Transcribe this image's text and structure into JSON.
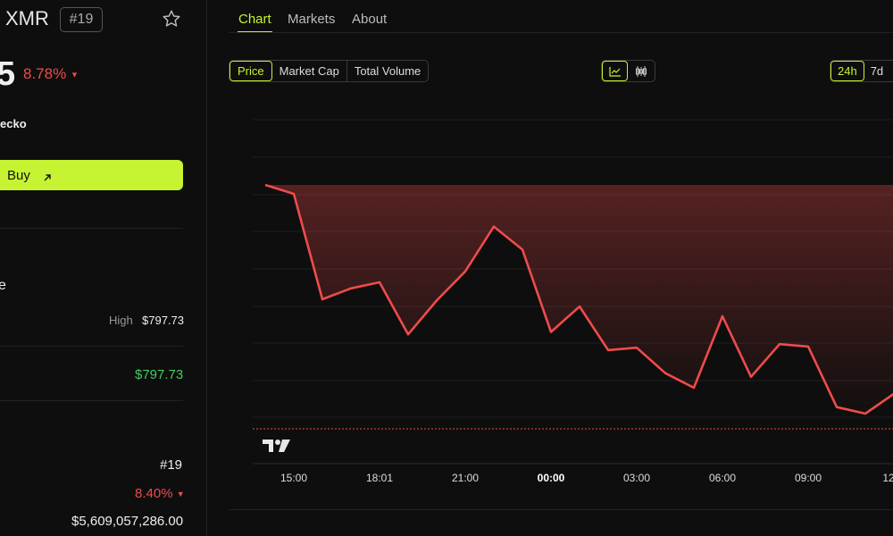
{
  "coin": {
    "ticker": "XMR",
    "rank_badge": "#19",
    "price_fragment": "5",
    "change_24h": "8.78%",
    "brand_fragment": "ecko",
    "buy_label": "Buy",
    "section_fragment": "e",
    "high_label": "High",
    "high_value": "$797.73",
    "green_value": "$797.73",
    "rank_value": "#19",
    "pct_value": "8.40%",
    "market_cap": "$5,609,057,286.00"
  },
  "tabs": [
    {
      "label": "Chart",
      "active": true
    },
    {
      "label": "Markets",
      "active": false
    },
    {
      "label": "About",
      "active": false
    }
  ],
  "metric_toggle": [
    {
      "label": "Price",
      "active": true
    },
    {
      "label": "Market Cap",
      "active": false
    },
    {
      "label": "Total Volume",
      "active": false
    }
  ],
  "chart_type_toggle": [
    {
      "icon": "line-chart-icon",
      "active": true
    },
    {
      "icon": "candlestick-icon",
      "active": false
    }
  ],
  "range_toggle": [
    {
      "label": "24h",
      "active": true
    },
    {
      "label": "7d",
      "active": false
    }
  ],
  "colors": {
    "accent": "#c6f432",
    "negative": "#ef4b4b",
    "positive": "#3fcf5a"
  },
  "chart_data": {
    "type": "line",
    "xlabels": [
      "15:00",
      "18:01",
      "21:00",
      "00:00",
      "03:00",
      "06:00",
      "09:00",
      "12"
    ],
    "values": [
      795.2,
      791.5,
      748.0,
      752.5,
      755.0,
      733.5,
      747.5,
      759.5,
      778.0,
      768.5,
      734.5,
      745.0,
      727.0,
      728.0,
      717.5,
      711.5,
      741.0,
      716.0,
      729.5,
      728.5,
      703.5,
      700.8,
      709.0
    ]
  }
}
